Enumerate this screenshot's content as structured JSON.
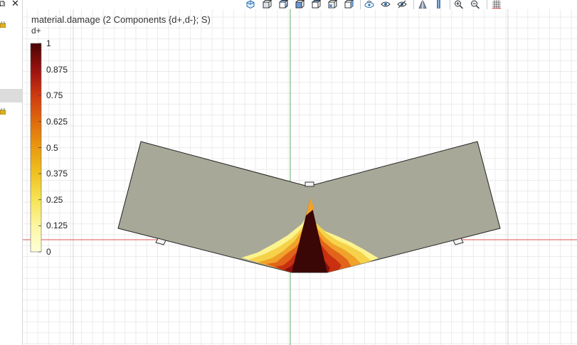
{
  "window": {
    "restore_glyph": "⧉",
    "close_glyph": "✕"
  },
  "toolbar": {
    "icons": [
      "view-cube-icon",
      "view-xy-icon",
      "view-yz-icon",
      "view-zx-icon",
      "view-front-icon",
      "view-back-icon",
      "view-left-icon",
      "scene-light-icon",
      "show-icon",
      "hide-icon",
      "transparency-icon",
      "render-icon",
      "zoom-in-icon",
      "zoom-out-icon",
      "grid-icon"
    ]
  },
  "plot": {
    "title": "material.damage (2 Components {d+,d-}; S)",
    "colorbar": {
      "label": "d+",
      "ticks": [
        "1",
        "0.875",
        "0.75",
        "0.625",
        "0.5",
        "0.375",
        "0.25",
        "0.125",
        "0"
      ],
      "min": 0,
      "max": 1
    },
    "colors": {
      "beam": "#a8a898",
      "axis_x": "#e05050",
      "axis_y": "#60b060",
      "grid": "#ebebeb",
      "damage_max": "#3a0606",
      "damage_mid": "#d43a14",
      "damage_low": "#f4d828"
    }
  }
}
